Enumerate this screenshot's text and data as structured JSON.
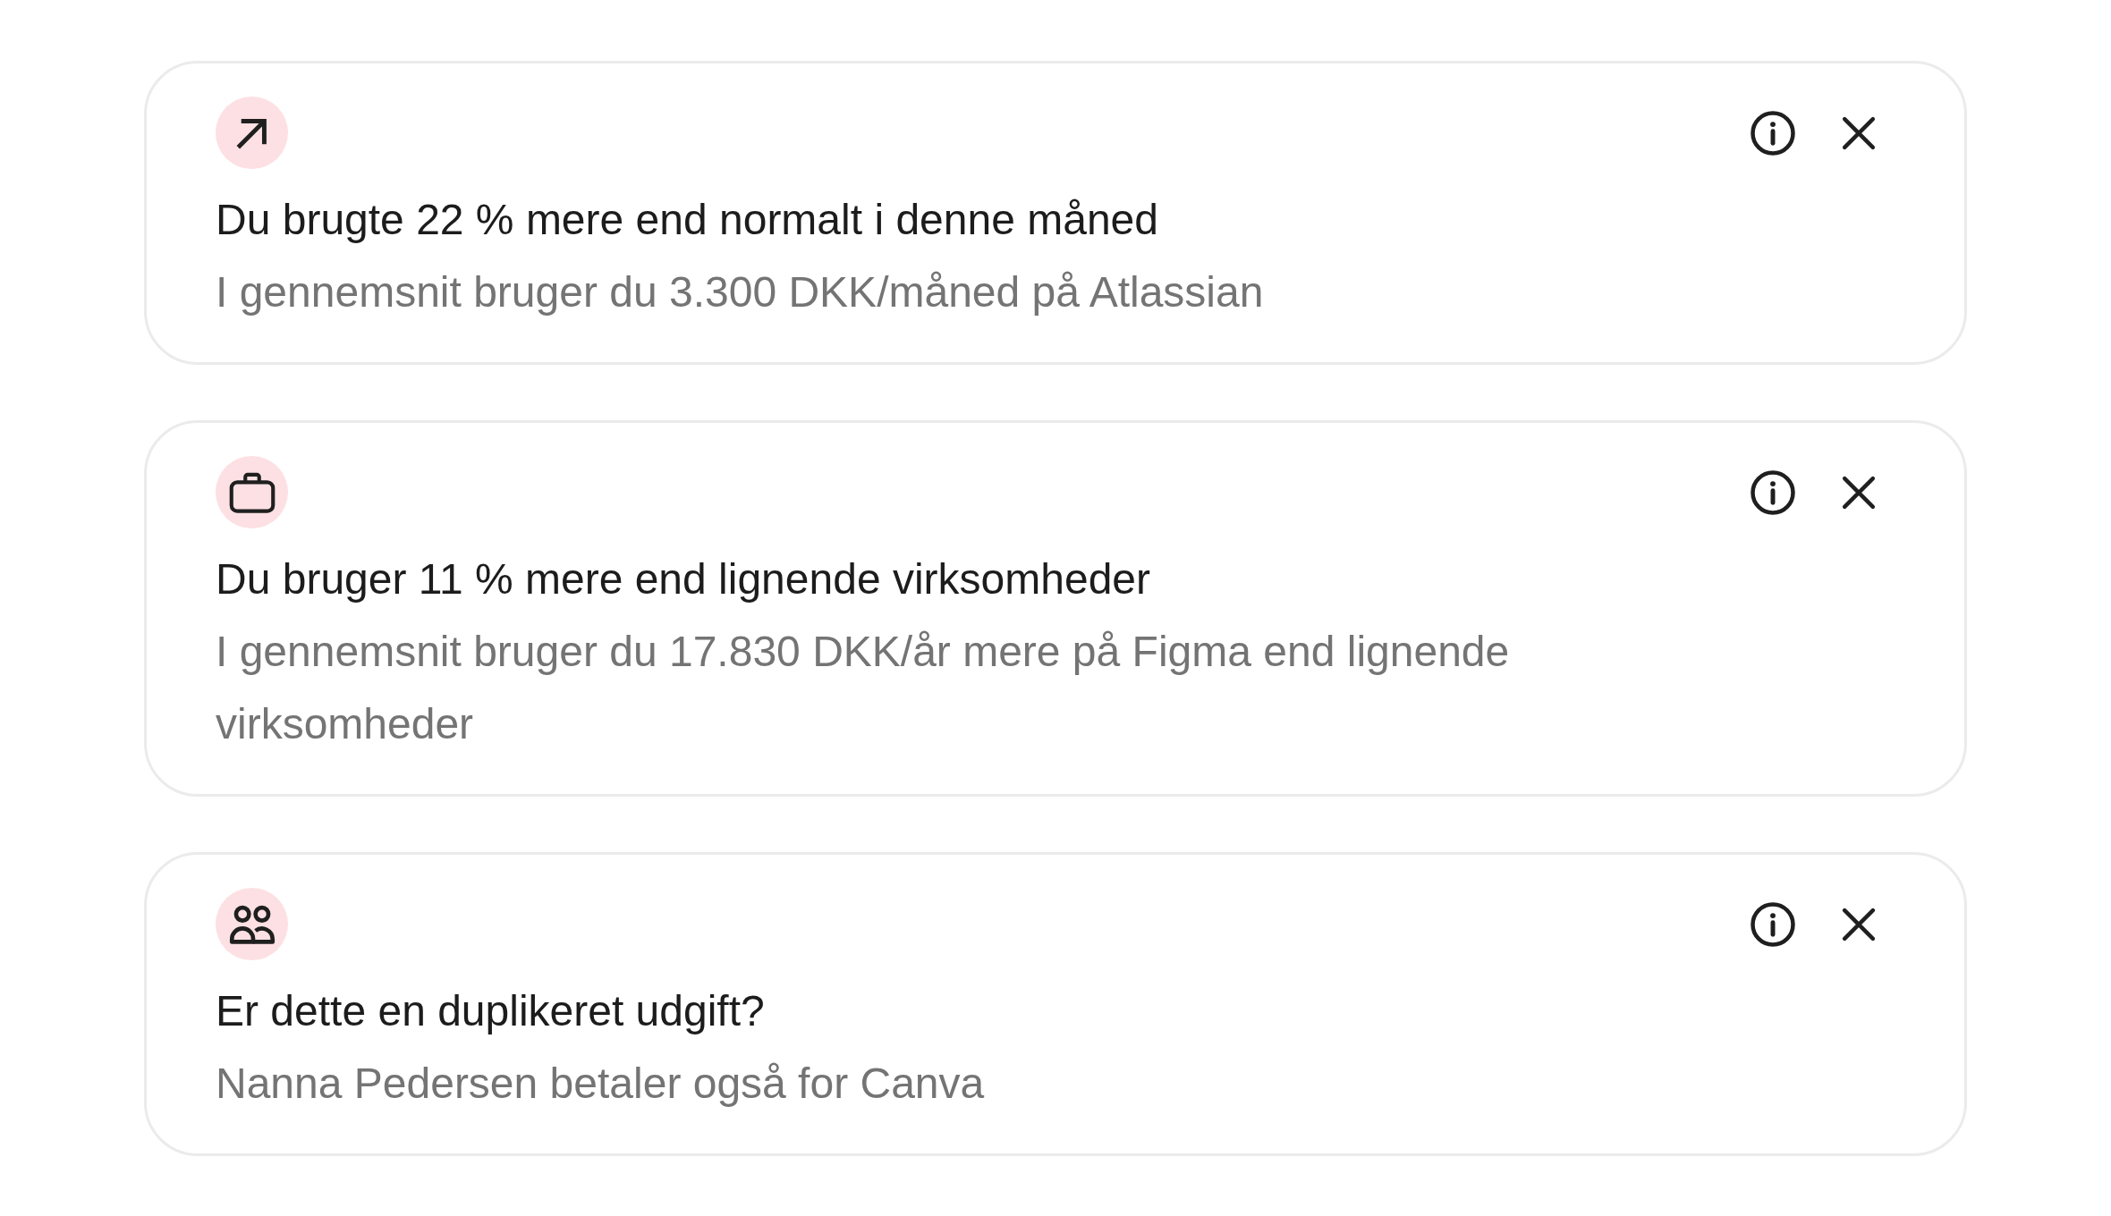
{
  "insights": [
    {
      "kind": "increase",
      "title": "Du brugte 22 % mere end normalt i denne måned",
      "description": "I gennemsnit bruger du 3.300 DKK/måned på Atlassian"
    },
    {
      "kind": "comparison",
      "title": "Du bruger 11 % mere end lignende virksomheder",
      "description": "I gennemsnit bruger du 17.830 DKK/år mere på Figma end lignende virksomheder"
    },
    {
      "kind": "duplicate",
      "title": "Er dette en duplikeret udgift?",
      "description": "Nanna Pedersen betaler også for Canva"
    }
  ]
}
